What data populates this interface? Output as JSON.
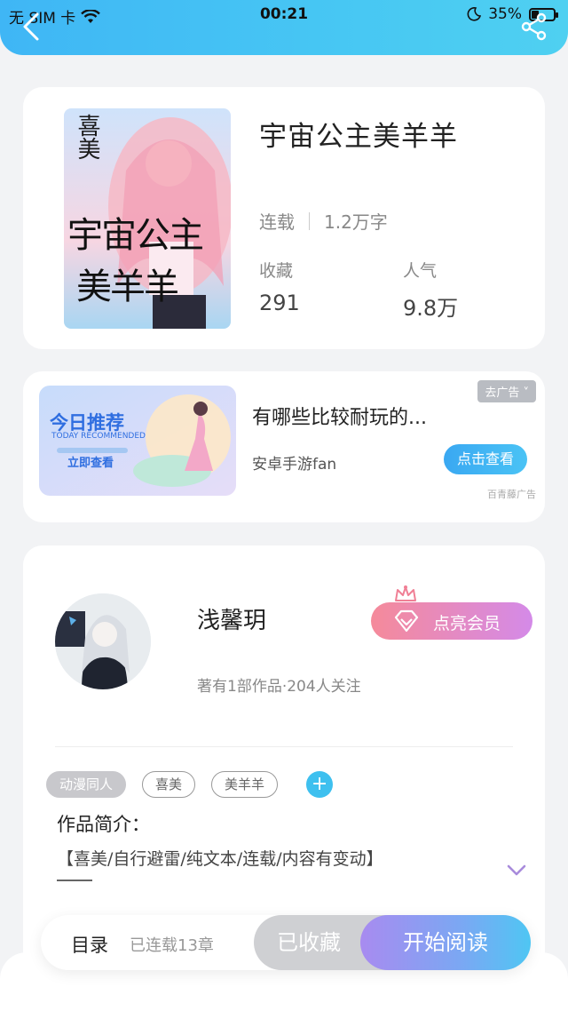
{
  "status_bar": {
    "carrier": "无 SIM 卡",
    "time": "00:21",
    "battery": "35%",
    "battery_level": 0.35
  },
  "header": {
    "back_icon": "chevron-left-icon",
    "share_icon": "share-icon"
  },
  "book": {
    "title": "宇宙公主美羊羊",
    "status": "连载",
    "word_count": "1.2万字",
    "favorites_label": "收藏",
    "favorites_value": "291",
    "popularity_label": "人气",
    "popularity_value": "9.8万",
    "cover_text_top": "喜美",
    "cover_text_main": "宇宙公主",
    "cover_text_bottom": "美羊羊"
  },
  "ad": {
    "image_title": "今日推荐",
    "image_subtitle": "TODAY RECOMMENDED",
    "image_button": "立即查看",
    "title": "有哪些比较耐玩的...",
    "source": "安卓手游fan",
    "close_label": "去广告 ˅",
    "action_label": "点击查看",
    "tag": "百青藤广告"
  },
  "author": {
    "name": "浅馨玥",
    "info": "著有1部作品·204人关注",
    "vip_label": "点亮会员",
    "tags": [
      "动漫同人",
      "喜美",
      "美羊羊"
    ],
    "intro_label": "作品简介：",
    "intro_text": "【喜美/自行避雷/纯文本/连载/内容有变动】"
  },
  "bottom_bar": {
    "catalog_label": "目录",
    "chapters_label": "已连载13章",
    "favorited_label": "已收藏",
    "read_label": "开始阅读"
  },
  "colors": {
    "header_blue": "#47c7f3",
    "accent_blue": "#3ec0ef",
    "vip_pink": "#f58a9a",
    "vip_purple": "#d48ae8",
    "read_gradient_start": "#a88bf0",
    "read_gradient_end": "#4fc6f3"
  }
}
